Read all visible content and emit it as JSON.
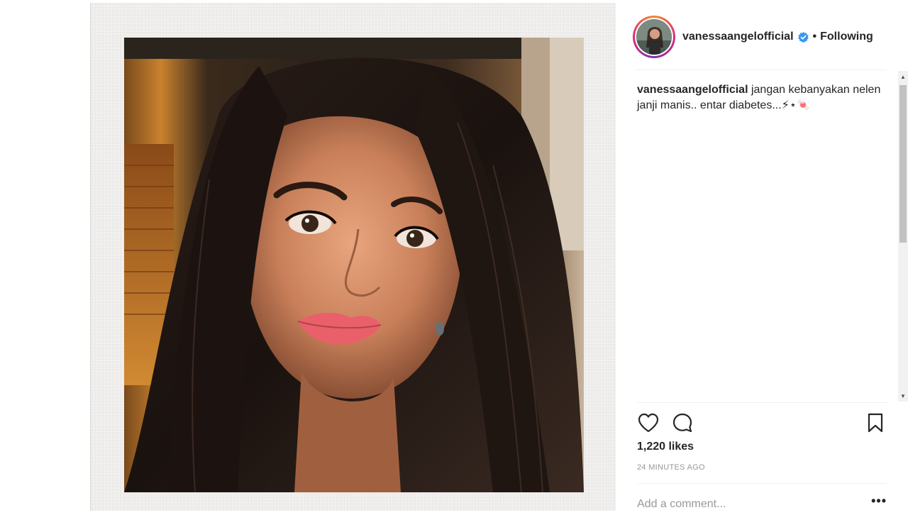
{
  "post": {
    "username": "vanessaangelofficial",
    "follow_status": "Following",
    "separator": "•",
    "caption_user": "vanessaangelofficial",
    "caption_text": "jangan kebanyakan nelen janji manis.. entar diabetes...⚡⋆🍬",
    "likes": "1,220 likes",
    "timestamp": "24 MINUTES AGO"
  },
  "comment": {
    "placeholder": "Add a comment...",
    "more_label": "•••"
  },
  "scrollbar": {
    "up": "▲",
    "down": "▼"
  },
  "icons": {
    "verified": "verified-badge-icon",
    "like": "heart-icon",
    "comment": "comment-bubble-icon",
    "save": "bookmark-icon"
  },
  "colors": {
    "verified_blue": "#3897f0",
    "text": "#262626",
    "muted": "#999999",
    "ring_start": "#f58529",
    "ring_mid": "#dd2a7b"
  }
}
